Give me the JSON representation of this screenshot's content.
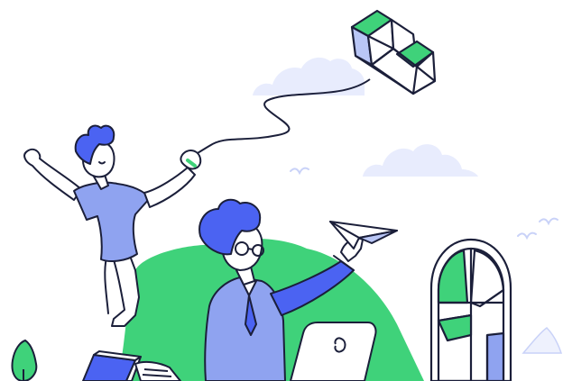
{
  "scene": {
    "subject": "illustration",
    "colors": {
      "blue": "#4B63F2",
      "light_blue": "#8FA3F0",
      "pale_blue": "#B9C6F6",
      "green": "#3FD27A",
      "green_dark": "#24B864",
      "cloud": "#E8ECFD",
      "outline": "#1B1F3A",
      "skin": "#FFFFFF"
    },
    "icons": [
      "kite-icon",
      "cloud-icon",
      "bird-icon",
      "paper-plane-icon",
      "laptop-icon",
      "arched-window-icon",
      "book-icon",
      "tree-icon"
    ]
  }
}
